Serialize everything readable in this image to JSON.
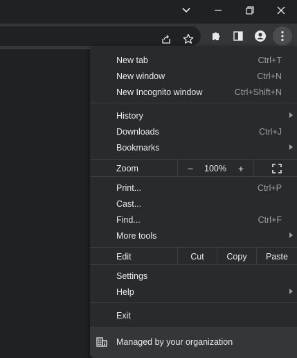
{
  "window": {
    "tab_search_icon": "chevron-down-icon",
    "minimize_icon": "minimize-icon",
    "restore_icon": "restore-icon",
    "close_icon": "close-icon"
  },
  "toolbar": {
    "icons": [
      "share-icon",
      "star-icon",
      "extensions-icon",
      "side-panel-icon",
      "profile-icon",
      "more-icon"
    ]
  },
  "menu": {
    "new_tab": {
      "label": "New tab",
      "shortcut": "Ctrl+T"
    },
    "new_window": {
      "label": "New window",
      "shortcut": "Ctrl+N"
    },
    "new_incognito": {
      "label": "New Incognito window",
      "shortcut": "Ctrl+Shift+N"
    },
    "history": {
      "label": "History"
    },
    "downloads": {
      "label": "Downloads",
      "shortcut": "Ctrl+J"
    },
    "bookmarks": {
      "label": "Bookmarks"
    },
    "zoom": {
      "label": "Zoom",
      "minus": "–",
      "value": "100%",
      "plus": "+"
    },
    "print": {
      "label": "Print...",
      "shortcut": "Ctrl+P"
    },
    "cast": {
      "label": "Cast..."
    },
    "find": {
      "label": "Find...",
      "shortcut": "Ctrl+F"
    },
    "more_tools": {
      "label": "More tools"
    },
    "edit": {
      "label": "Edit",
      "cut": "Cut",
      "copy": "Copy",
      "paste": "Paste"
    },
    "settings": {
      "label": "Settings"
    },
    "help": {
      "label": "Help"
    },
    "exit": {
      "label": "Exit"
    },
    "managed": {
      "label": "Managed by your organization"
    }
  },
  "colors": {
    "background": "#202124",
    "toolbar": "#35363a",
    "menu": "#292a2d",
    "text": "#e8eaed",
    "muted": "#9aa0a6"
  }
}
